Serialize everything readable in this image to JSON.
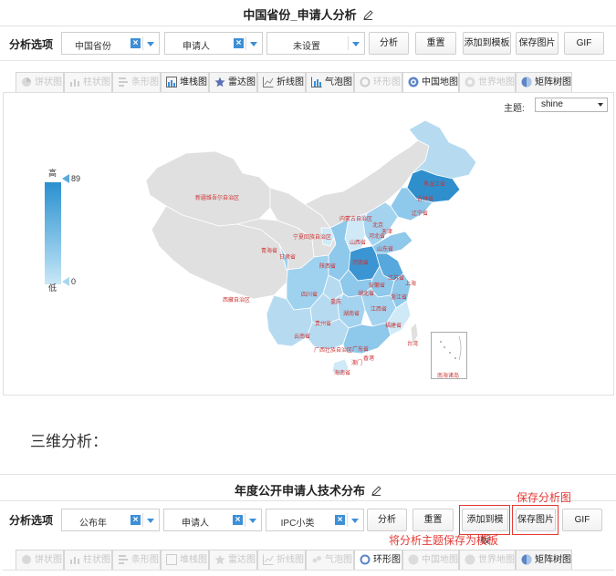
{
  "panel1": {
    "title": "中国省份_申请人分析",
    "options_label": "分析选项",
    "selects": [
      {
        "value": "中国省份"
      },
      {
        "value": "申请人"
      },
      {
        "value": "未设置"
      }
    ],
    "buttons": [
      "分析",
      "重置",
      "添加到模板",
      "保存图片",
      "GIF"
    ],
    "tabs": [
      {
        "label": "饼状图",
        "icon": "pie-icon",
        "enabled": false
      },
      {
        "label": "柱状图",
        "icon": "bar-icon",
        "enabled": false
      },
      {
        "label": "条形图",
        "icon": "hbar-icon",
        "enabled": false
      },
      {
        "label": "堆栈图",
        "icon": "stack-icon",
        "enabled": true
      },
      {
        "label": "雷达图",
        "icon": "radar-icon",
        "enabled": true
      },
      {
        "label": "折线图",
        "icon": "line-icon",
        "enabled": true
      },
      {
        "label": "气泡图",
        "icon": "bubble-icon",
        "enabled": true
      },
      {
        "label": "环形图",
        "icon": "ring-icon",
        "enabled": false
      },
      {
        "label": "中国地图",
        "icon": "china-map-icon",
        "enabled": true
      },
      {
        "label": "世界地图",
        "icon": "world-map-icon",
        "enabled": false
      },
      {
        "label": "矩阵树图",
        "icon": "treemap-icon",
        "enabled": true
      }
    ],
    "active_tab": "中国地图",
    "theme_label": "主题:",
    "theme_value": "shine",
    "legend": {
      "high_label": "高",
      "low_label": "低",
      "max": "89",
      "min": "0",
      "color_high": "#2a90cf",
      "color_low": "#cbe8f6"
    },
    "provinces": [
      {
        "name": "黑龙江省"
      },
      {
        "name": "吉林省"
      },
      {
        "name": "辽宁省"
      },
      {
        "name": "新疆维吾尔自治区"
      },
      {
        "name": "内蒙古自治区"
      },
      {
        "name": "北京"
      },
      {
        "name": "天津"
      },
      {
        "name": "河北省"
      },
      {
        "name": "山西省"
      },
      {
        "name": "山东省"
      },
      {
        "name": "宁夏回族自治区"
      },
      {
        "name": "青海省"
      },
      {
        "name": "甘肃省"
      },
      {
        "name": "陕西省"
      },
      {
        "name": "河南省"
      },
      {
        "name": "江苏省"
      },
      {
        "name": "上海"
      },
      {
        "name": "安徽省"
      },
      {
        "name": "浙江省"
      },
      {
        "name": "西藏自治区"
      },
      {
        "name": "四川省"
      },
      {
        "name": "重庆"
      },
      {
        "name": "湖北省"
      },
      {
        "name": "湖南省"
      },
      {
        "name": "江西省"
      },
      {
        "name": "福建省"
      },
      {
        "name": "贵州省"
      },
      {
        "name": "云南省"
      },
      {
        "name": "广西壮族自治区"
      },
      {
        "name": "广东省"
      },
      {
        "name": "香港"
      },
      {
        "name": "澳门"
      },
      {
        "name": "海南省"
      },
      {
        "name": "台湾"
      },
      {
        "name": "南海诸岛"
      }
    ]
  },
  "caption": "三维分析：",
  "panel2": {
    "title": "年度公开申请人技术分布",
    "options_label": "分析选项",
    "selects": [
      {
        "value": "公布年"
      },
      {
        "value": "申请人"
      },
      {
        "value": "IPC小类"
      }
    ],
    "buttons": [
      "分析",
      "重置",
      "添加到模板",
      "保存图片",
      "GIF"
    ],
    "annotations": {
      "save_image": "保存分析图",
      "save_template": "将分析主题保存为模板"
    },
    "tabs": [
      {
        "label": "饼状图",
        "enabled": false
      },
      {
        "label": "柱状图",
        "enabled": false
      },
      {
        "label": "条形图",
        "enabled": false
      },
      {
        "label": "堆栈图",
        "enabled": false
      },
      {
        "label": "雷达图",
        "enabled": false
      },
      {
        "label": "折线图",
        "enabled": false
      },
      {
        "label": "气泡图",
        "enabled": false
      },
      {
        "label": "环形图",
        "enabled": true
      },
      {
        "label": "中国地图",
        "enabled": false
      },
      {
        "label": "世界地图",
        "enabled": false
      },
      {
        "label": "矩阵树图",
        "enabled": true
      }
    ],
    "active_tab": "环形图",
    "highlight_color": "#e53935"
  }
}
